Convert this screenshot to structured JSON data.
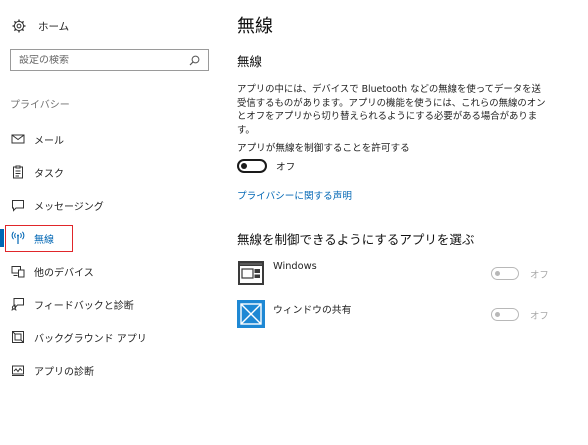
{
  "sidebar": {
    "home_label": "ホーム",
    "search_placeholder": "設定の検索",
    "section_label": "プライバシー",
    "items": [
      {
        "icon": "message-envelope-icon",
        "label": "メール"
      },
      {
        "icon": "tasks-icon",
        "label": "タスク"
      },
      {
        "icon": "messaging-icon",
        "label": "メッセージング"
      },
      {
        "icon": "radio-antenna-icon",
        "label": "無線"
      },
      {
        "icon": "other-devices-icon",
        "label": "他のデバイス"
      },
      {
        "icon": "feedback-icon",
        "label": "フィードバックと診断"
      },
      {
        "icon": "background-apps-icon",
        "label": "バックグラウンド アプリ"
      },
      {
        "icon": "app-diagnostics-icon",
        "label": "アプリの診断"
      }
    ],
    "active_index": 3
  },
  "main": {
    "title": "無線",
    "subtitle": "無線",
    "description": "アプリの中には、デバイスで Bluetooth などの無線を使ってデータを送受信するものがあります。アプリの機能を使うには、これらの無線のオンとオフをアプリから切り替えられるようにする必要がある場合があります。",
    "allow_label": "アプリが無線を制御することを許可する",
    "allow_state": "オフ",
    "privacy_link": "プライバシーに関する声明",
    "apps_heading": "無線を制御できるようにするアプリを選ぶ",
    "apps": [
      {
        "name": "Windows",
        "state": "オフ",
        "icon": "windows-app-icon"
      },
      {
        "name": "ウィンドウの共有",
        "state": "オフ",
        "icon": "window-share-app-icon"
      }
    ]
  },
  "colors": {
    "accent": "#0066b4",
    "highlight_box": "#e0262a",
    "share_app_tile": "#1e88d4"
  }
}
